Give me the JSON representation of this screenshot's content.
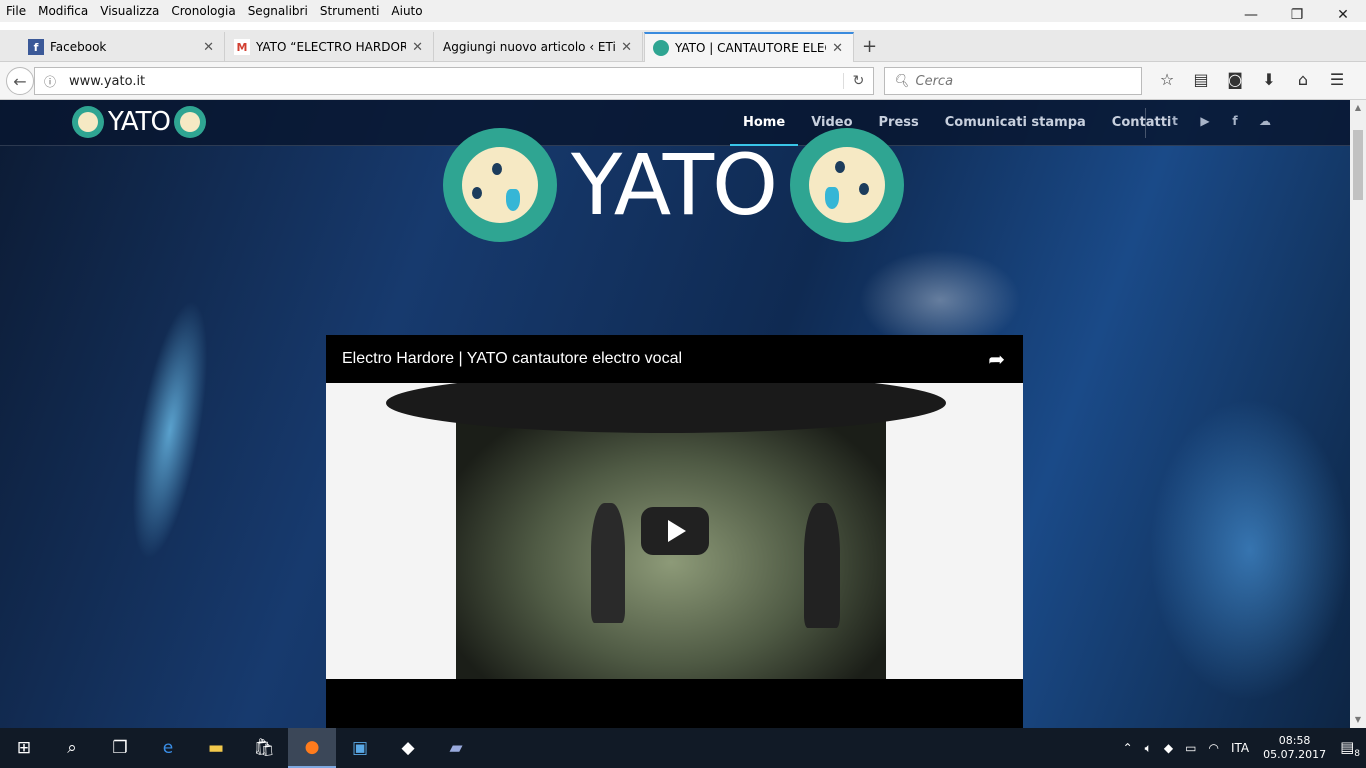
{
  "menubar": [
    "File",
    "Modifica",
    "Visualizza",
    "Cronologia",
    "Segnalibri",
    "Strumenti",
    "Aiuto"
  ],
  "tabs": [
    {
      "title": "Facebook",
      "favicon": "facebook-icon",
      "color": "#3b5998"
    },
    {
      "title": "YATO “ELECTRO HARDORE”",
      "favicon": "gmail-icon",
      "color": "#d23f31"
    },
    {
      "title": "Aggiungi nuovo articolo ‹ ETiCin",
      "favicon": "none"
    },
    {
      "title": "YATO | CANTAUTORE ELECT",
      "favicon": "yato-icon",
      "color": "#2fa592",
      "active": true
    }
  ],
  "address": {
    "url": "www.yato.it"
  },
  "search": {
    "placeholder": "Cerca"
  },
  "site": {
    "logo": "YATO",
    "nav": [
      "Home",
      "Video",
      "Press",
      "Comunicati stampa",
      "Contatti"
    ],
    "social": [
      "twitter-icon",
      "youtube-icon",
      "facebook-icon",
      "soundcloud-icon"
    ],
    "accent": "#39c5e8"
  },
  "hero": {
    "logo": "YATO"
  },
  "video": {
    "title": "Electro Hardore | YATO cantautore electro vocal"
  },
  "taskbar": {
    "lang": "ITA",
    "time": "08:58",
    "date": "05.07.2017",
    "notifications": "8"
  }
}
